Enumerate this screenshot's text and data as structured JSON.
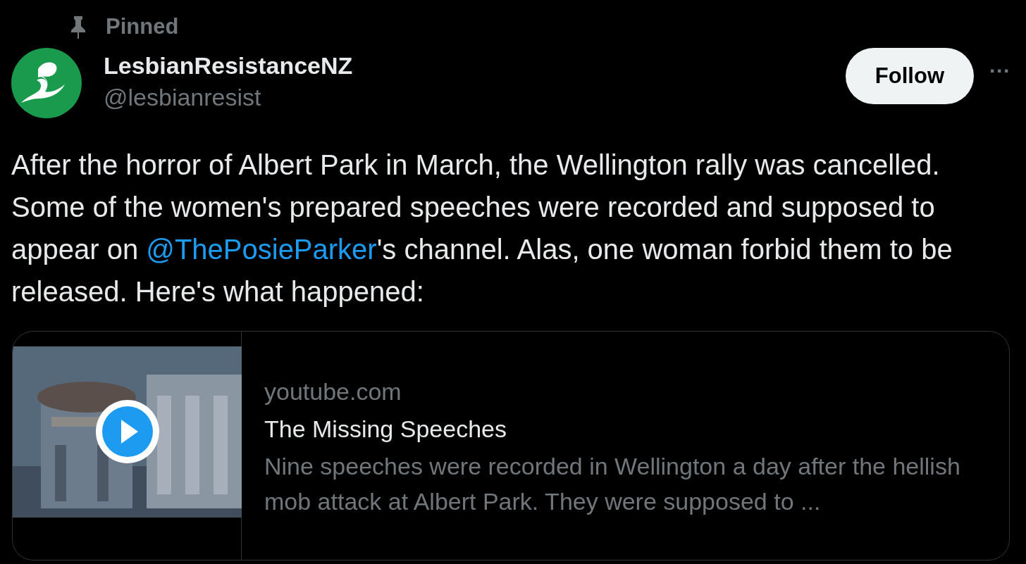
{
  "social_context": {
    "label": "Pinned"
  },
  "author": {
    "name": "LesbianResistanceNZ",
    "handle": "@lesbianresist"
  },
  "follow_button": {
    "label": "Follow"
  },
  "more_button": {
    "label": "···"
  },
  "tweet_text": [
    {
      "kind": "text",
      "text": "After the horror of Albert Park in March, the Wellington rally was cancelled. Some of the women's prepared speeches were recorded and supposed to appear on "
    },
    {
      "kind": "mention",
      "text": "@ThePosieParker"
    },
    {
      "kind": "text",
      "text": "'s channel. Alas, one woman forbid them to be released. Here's what happened:"
    }
  ],
  "link_card": {
    "domain": "youtube.com",
    "title": "The Missing Speeches",
    "description": "Nine speeches were recorded in Wellington a day after the hellish mob attack at Albert Park. They were supposed to ..."
  }
}
